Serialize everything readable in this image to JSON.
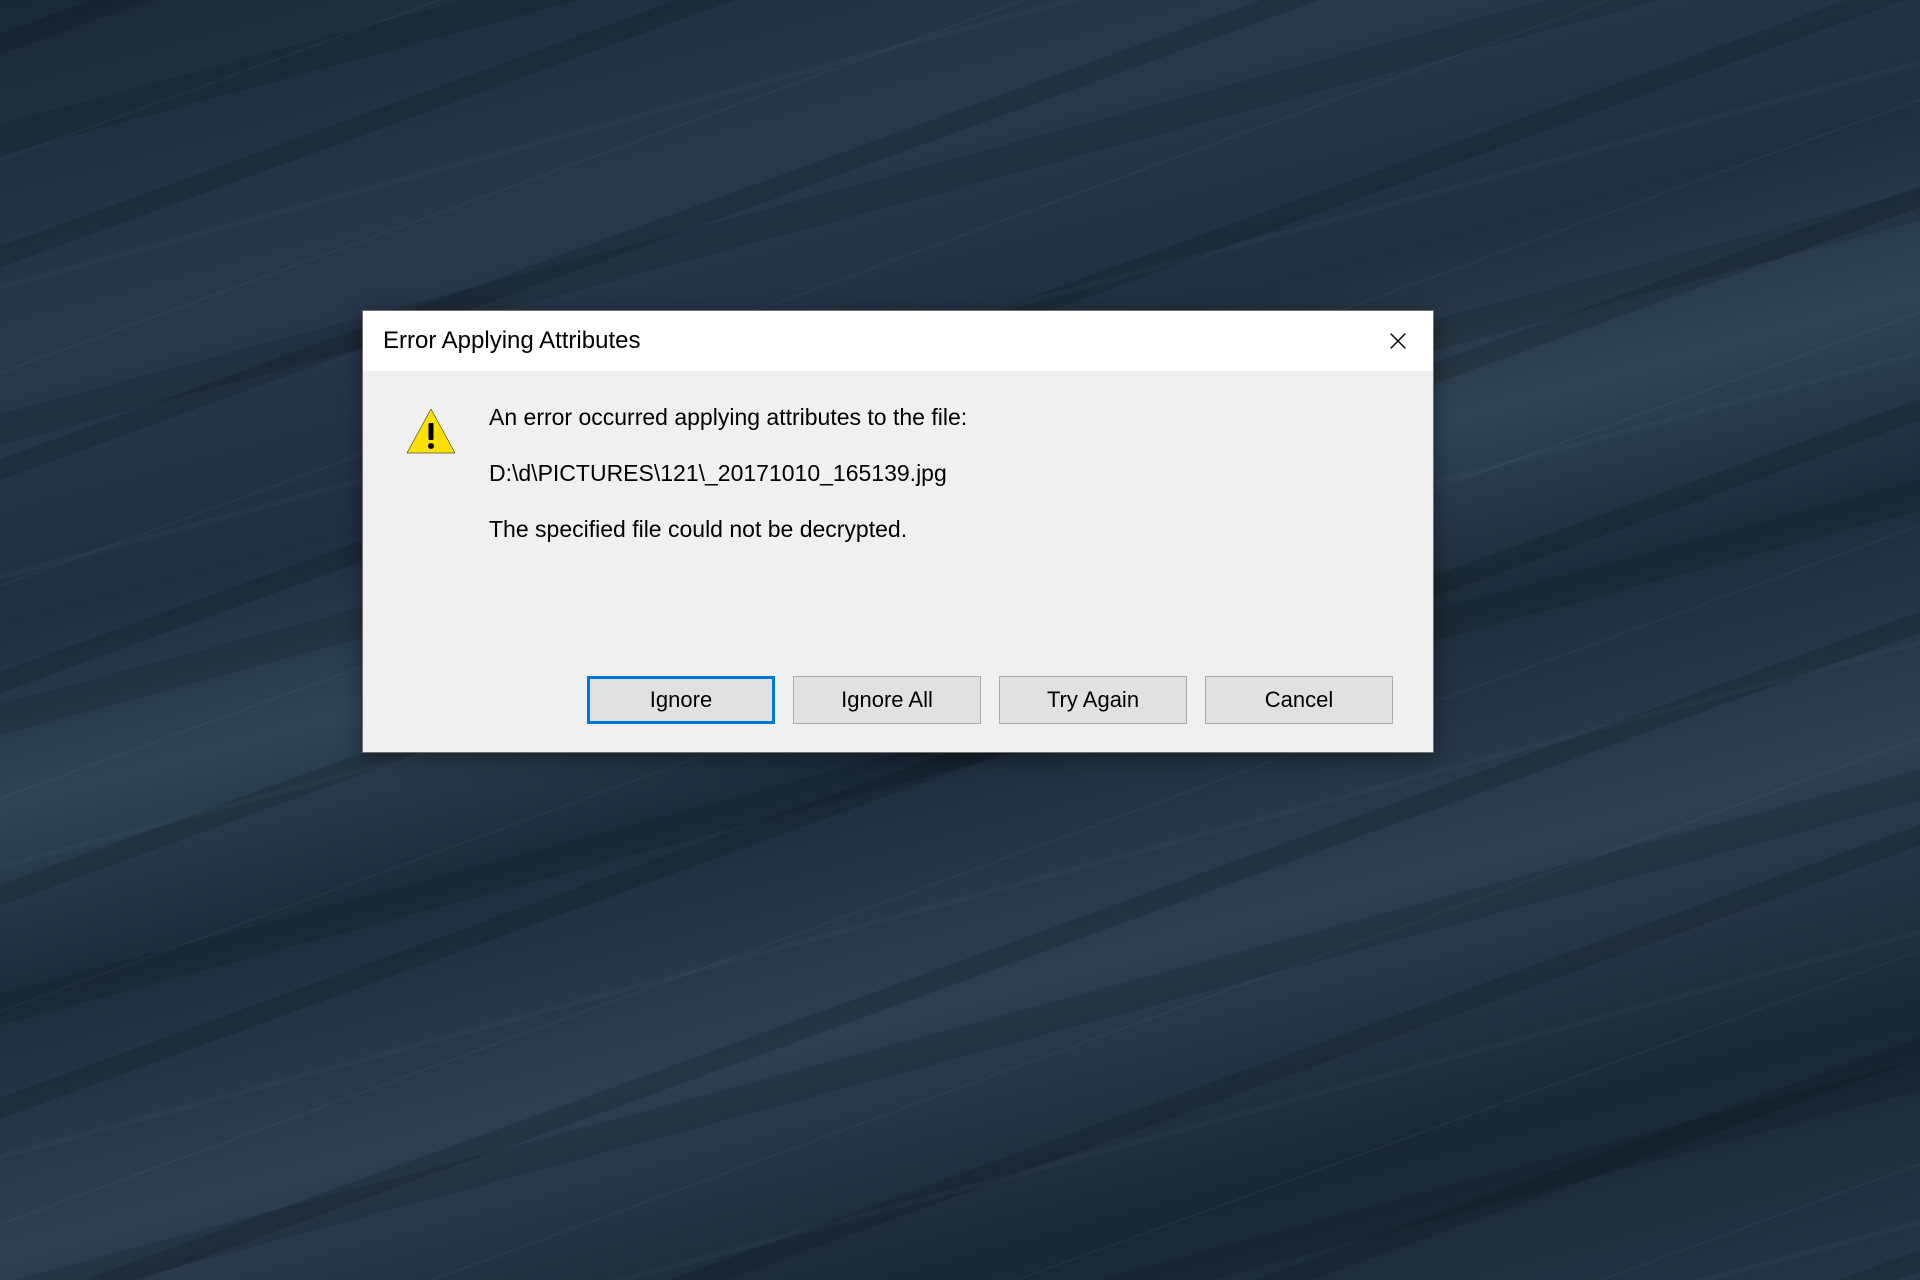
{
  "dialog": {
    "title": "Error Applying Attributes",
    "message_line1": "An error occurred applying attributes to the file:",
    "message_path": "D:\\d\\PICTURES\\121\\_20171010_165139.jpg",
    "message_error": "The specified file could not be decrypted.",
    "buttons": {
      "ignore": "Ignore",
      "ignore_all": "Ignore All",
      "try_again": "Try Again",
      "cancel": "Cancel"
    }
  }
}
